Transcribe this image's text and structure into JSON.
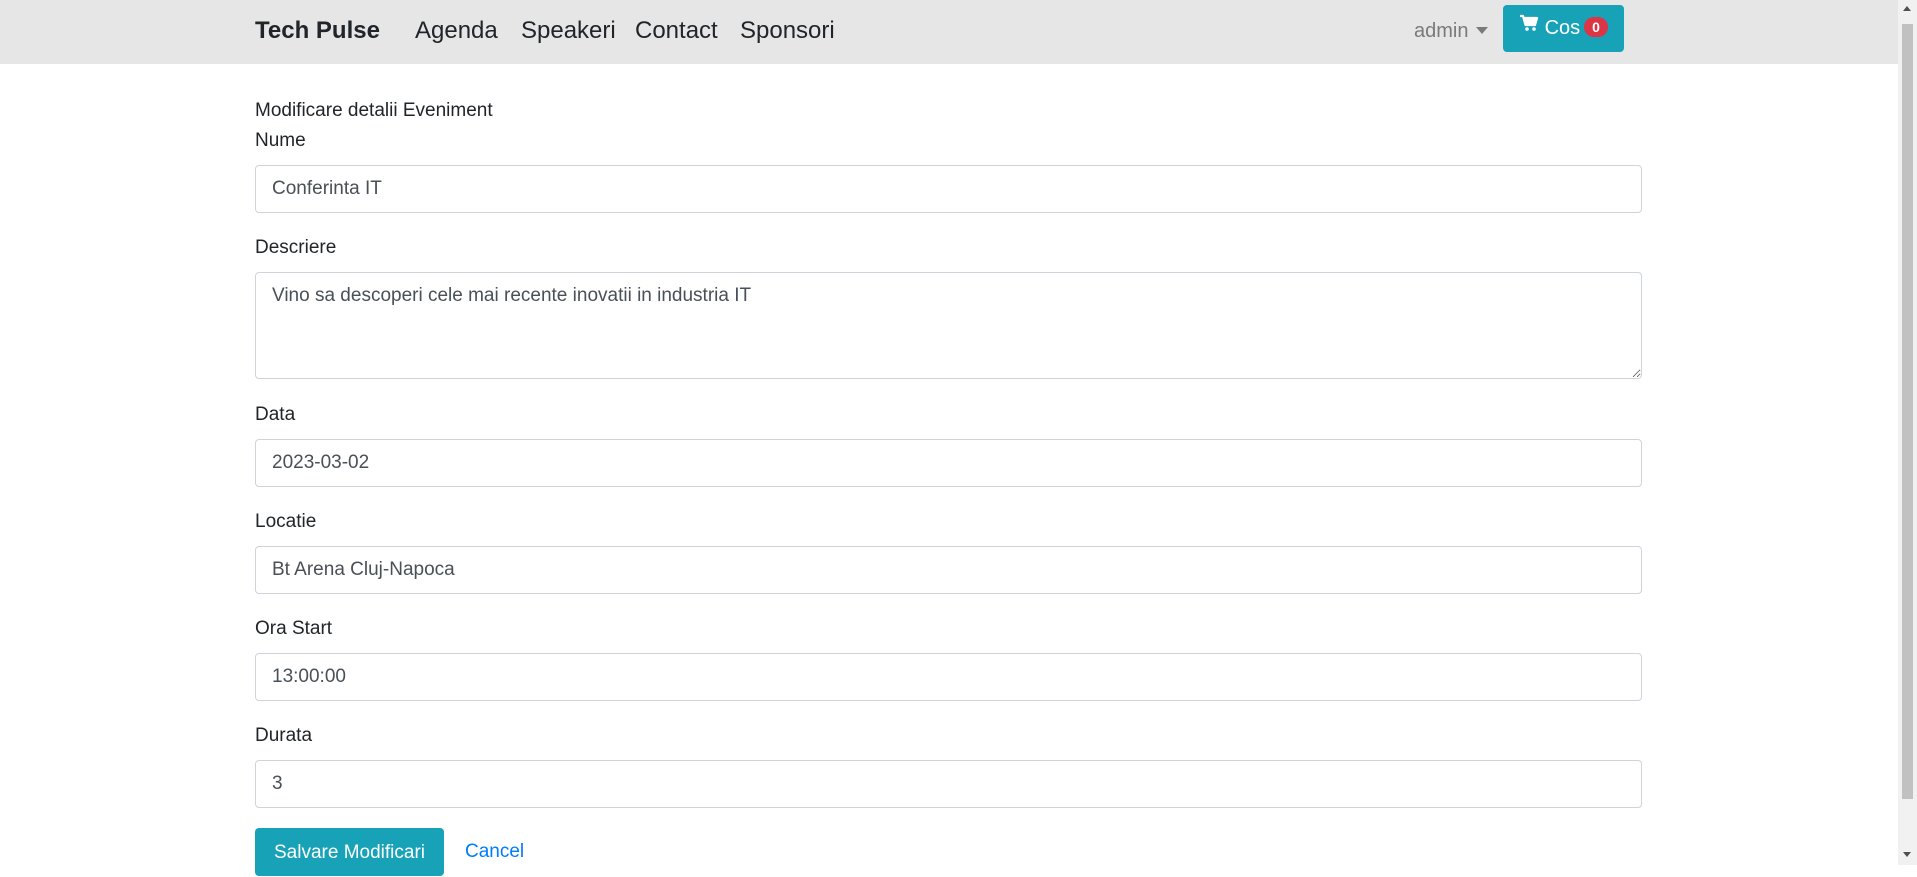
{
  "navbar": {
    "brand": "Tech Pulse",
    "links": [
      "Agenda",
      "Speakeri",
      "Contact",
      "Sponsori"
    ],
    "user": "admin",
    "cart": {
      "label": "Cos",
      "count": "0",
      "icon": "shopping-cart-icon"
    }
  },
  "form": {
    "title": "Modificare detalii Eveniment",
    "fields": {
      "nume": {
        "label": "Nume",
        "value": "Conferinta IT"
      },
      "descriere": {
        "label": "Descriere",
        "value": "Vino sa descoperi cele mai recente inovatii in industria IT"
      },
      "data": {
        "label": "Data",
        "value": "2023-03-02"
      },
      "locatie": {
        "label": "Locatie",
        "value": "Bt Arena Cluj-Napoca"
      },
      "ora_start": {
        "label": "Ora Start",
        "value": "13:00:00"
      },
      "durata": {
        "label": "Durata",
        "value": "3"
      }
    },
    "save_label": "Salvare Modificari",
    "cancel_label": "Cancel"
  },
  "colors": {
    "navbar_bg": "#e6e6e6",
    "primary_info": "#17a2b8",
    "badge_danger": "#dc3545",
    "link": "#007bff"
  }
}
